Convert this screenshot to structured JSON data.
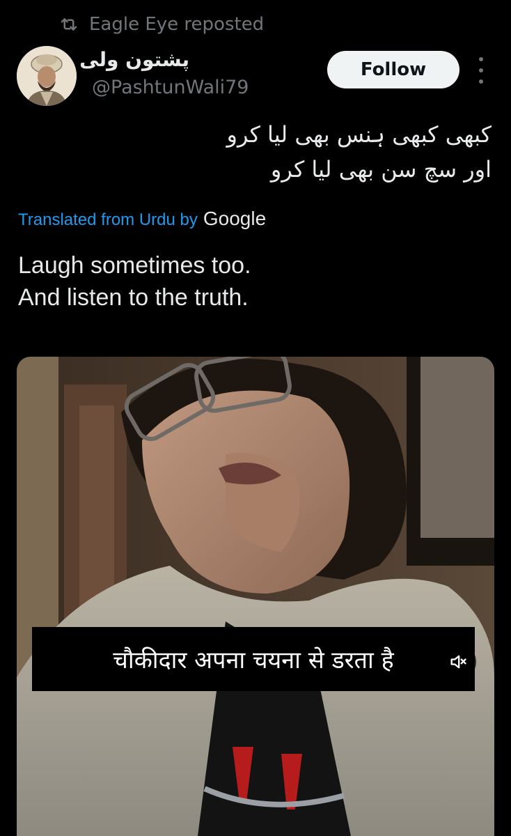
{
  "repost": {
    "icon": "repost-icon",
    "text": "Eagle Eye reposted"
  },
  "author": {
    "display_name": "پشتون ولی",
    "handle": "@PashtunWali79",
    "avatar_icon": "avatar-portrait"
  },
  "actions": {
    "follow_label": "Follow",
    "more_icon": "more-options-icon"
  },
  "tweet": {
    "lines": [
      "کبھی کبھی ہنس بھی لیا کرو",
      "اور سچ سن بھی لیا کرو"
    ],
    "translated_label": "Translated from Urdu by",
    "translation_provider": "Google",
    "translation_lines": [
      "Laugh sometimes too.",
      "And listen to the truth."
    ]
  },
  "media": {
    "subtitle": "चौकीदार अपना चयना से डरता है",
    "mute_icon": "speaker-muted-icon"
  },
  "colors": {
    "background": "#000000",
    "text_primary": "#e7e9ea",
    "text_secondary": "#71767b",
    "link": "#1d9bf0",
    "follow_bg": "#eff3f4"
  }
}
